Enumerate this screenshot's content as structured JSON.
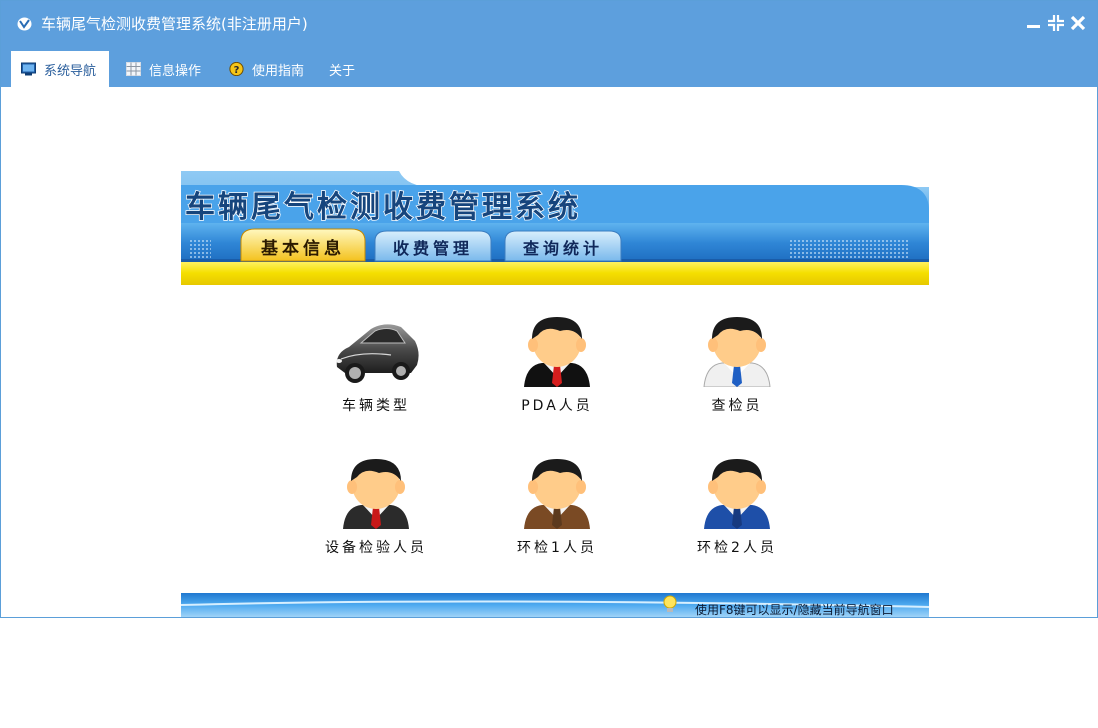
{
  "window": {
    "title": "车辆尾气检测收费管理系统(非注册用户)"
  },
  "menu": {
    "tabs": [
      {
        "label": "系统导航",
        "icon": "monitor-icon",
        "active": true
      },
      {
        "label": "信息操作",
        "icon": "grid-icon",
        "active": false
      },
      {
        "label": "使用指南",
        "icon": "help-icon",
        "active": false
      },
      {
        "label": "关于",
        "icon": "",
        "active": false
      }
    ]
  },
  "banner": {
    "title": "车辆尾气检测收费管理系统",
    "tabs": [
      "基本信息",
      "收费管理",
      "查询统计"
    ]
  },
  "nav_items": [
    {
      "label": "车辆类型",
      "icon": "car-icon"
    },
    {
      "label": "PDA人员",
      "icon": "person-red-tie-icon"
    },
    {
      "label": "查检员",
      "icon": "person-blue-tie-icon"
    },
    {
      "label": "设备检验人员",
      "icon": "person-dark-suit-icon"
    },
    {
      "label": "环检1人员",
      "icon": "person-brown-suit-icon"
    },
    {
      "label": "环检2人员",
      "icon": "person-blue-suit-icon"
    }
  ],
  "footer": {
    "hint": "使用F8键可以显示/隐藏当前导航窗口"
  },
  "colors": {
    "titlebar": "#5d9fdd",
    "banner_blue": "#3a8fd9",
    "banner_yellow": "#f6e000"
  }
}
